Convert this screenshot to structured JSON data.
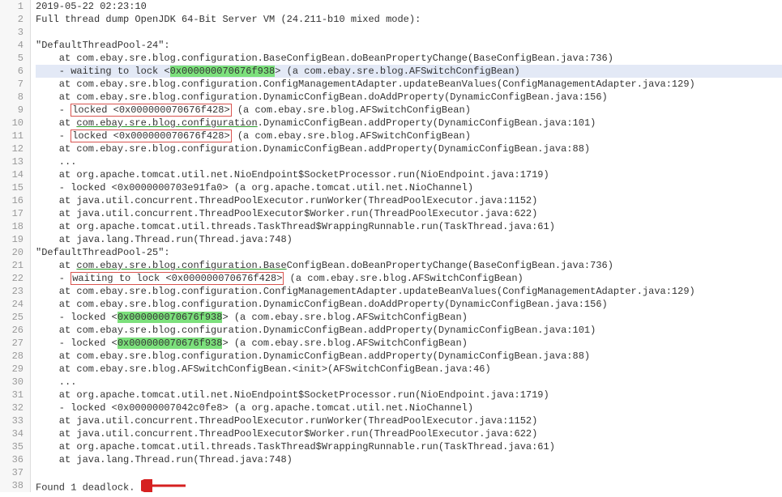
{
  "lines": [
    {
      "num": 1,
      "text": "2019-05-22 02:23:10"
    },
    {
      "num": 2,
      "text": "Full thread dump OpenJDK 64-Bit Server VM (24.211-b10 mixed mode):"
    },
    {
      "num": 3,
      "text": ""
    },
    {
      "num": 4,
      "text": "\"DefaultThreadPool-24\":"
    },
    {
      "num": 5,
      "text": "    at com.ebay.sre.blog.configuration.BaseConfigBean.doBeanPropertyChange(BaseConfigBean.java:736)"
    },
    {
      "num": 6,
      "highlighted": true,
      "parts": [
        {
          "t": "    - waiting to lock <"
        },
        {
          "t": "0x000000070676f938",
          "hlGreen": true
        },
        {
          "t": "> (a com.ebay.sre.blog.AFSwitchConfigBean)"
        }
      ]
    },
    {
      "num": 7,
      "text": "    at com.ebay.sre.blog.configuration.ConfigManagementAdapter.updateBeanValues(ConfigManagementAdapter.java:129)"
    },
    {
      "num": 8,
      "text": "    at com.ebay.sre.blog.configuration.DynamicConfigBean.doAddProperty(DynamicConfigBean.java:156)"
    },
    {
      "num": 9,
      "parts": [
        {
          "t": "    - "
        },
        {
          "t": "locked <0x000000070676f428>",
          "redBox": true
        },
        {
          "t": " (a com.ebay.sre.blog.AFSwitchConfigBean)"
        }
      ]
    },
    {
      "num": 10,
      "parts": [
        {
          "t": "    at "
        },
        {
          "t": "com.ebay.sre.blog.configuration",
          "greenUnderline": true
        },
        {
          "t": ".DynamicConfigBean.addProperty(DynamicConfigBean.java:101)"
        }
      ]
    },
    {
      "num": 11,
      "parts": [
        {
          "t": "    - "
        },
        {
          "t": "locked <0x000000070676f428>",
          "redBox": true
        },
        {
          "t": " (a com.ebay.sre.blog.AFSwitchConfigBean)"
        }
      ]
    },
    {
      "num": 12,
      "text": "    at com.ebay.sre.blog.configuration.DynamicConfigBean.addProperty(DynamicConfigBean.java:88)"
    },
    {
      "num": 13,
      "text": "    ..."
    },
    {
      "num": 14,
      "text": "    at org.apache.tomcat.util.net.NioEndpoint$SocketProcessor.run(NioEndpoint.java:1719)"
    },
    {
      "num": 15,
      "text": "    - locked <0x0000000703e91fa0> (a org.apache.tomcat.util.net.NioChannel)"
    },
    {
      "num": 16,
      "text": "    at java.util.concurrent.ThreadPoolExecutor.runWorker(ThreadPoolExecutor.java:1152)"
    },
    {
      "num": 17,
      "text": "    at java.util.concurrent.ThreadPoolExecutor$Worker.run(ThreadPoolExecutor.java:622)"
    },
    {
      "num": 18,
      "text": "    at org.apache.tomcat.util.threads.TaskThread$WrappingRunnable.run(TaskThread.java:61)"
    },
    {
      "num": 19,
      "text": "    at java.lang.Thread.run(Thread.java:748)"
    },
    {
      "num": 20,
      "text": "\"DefaultThreadPool-25\":"
    },
    {
      "num": 21,
      "parts": [
        {
          "t": "    at "
        },
        {
          "t": "com.ebay.sre.blog.configuration.Base",
          "greenUnderline": true
        },
        {
          "t": "ConfigBean.doBeanPropertyChange(BaseConfigBean.java:736)"
        }
      ]
    },
    {
      "num": 22,
      "parts": [
        {
          "t": "    - "
        },
        {
          "t": "waiting to lock <0x000000070676f428>",
          "redBox": true
        },
        {
          "t": " (a com.ebay.sre.blog.AFSwitchConfigBean)"
        }
      ]
    },
    {
      "num": 23,
      "text": "    at com.ebay.sre.blog.configuration.ConfigManagementAdapter.updateBeanValues(ConfigManagementAdapter.java:129)"
    },
    {
      "num": 24,
      "text": "    at com.ebay.sre.blog.configuration.DynamicConfigBean.doAddProperty(DynamicConfigBean.java:156)"
    },
    {
      "num": 25,
      "parts": [
        {
          "t": "    - locked <"
        },
        {
          "t": "0x000000070676f938",
          "hlGreen": true
        },
        {
          "t": "> (a com.ebay.sre.blog.AFSwitchConfigBean)"
        }
      ]
    },
    {
      "num": 26,
      "text": "    at com.ebay.sre.blog.configuration.DynamicConfigBean.addProperty(DynamicConfigBean.java:101)"
    },
    {
      "num": 27,
      "parts": [
        {
          "t": "    - locked <"
        },
        {
          "t": "0x000000070676f938",
          "hlGreen": true
        },
        {
          "t": "> (a com.ebay.sre.blog.AFSwitchConfigBean)"
        }
      ]
    },
    {
      "num": 28,
      "text": "    at com.ebay.sre.blog.configuration.DynamicConfigBean.addProperty(DynamicConfigBean.java:88)"
    },
    {
      "num": 29,
      "text": "    at com.ebay.sre.blog.AFSwitchConfigBean.<init>(AFSwitchConfigBean.java:46)"
    },
    {
      "num": 30,
      "text": "    ..."
    },
    {
      "num": 31,
      "text": "    at org.apache.tomcat.util.net.NioEndpoint$SocketProcessor.run(NioEndpoint.java:1719)"
    },
    {
      "num": 32,
      "text": "    - locked <0x00000007042c0fe8> (a org.apache.tomcat.util.net.NioChannel)"
    },
    {
      "num": 33,
      "text": "    at java.util.concurrent.ThreadPoolExecutor.runWorker(ThreadPoolExecutor.java:1152)"
    },
    {
      "num": 34,
      "text": "    at java.util.concurrent.ThreadPoolExecutor$Worker.run(ThreadPoolExecutor.java:622)"
    },
    {
      "num": 35,
      "text": "    at org.apache.tomcat.util.threads.TaskThread$WrappingRunnable.run(TaskThread.java:61)"
    },
    {
      "num": 36,
      "text": "    at java.lang.Thread.run(Thread.java:748)"
    },
    {
      "num": 37,
      "text": ""
    },
    {
      "num": 38,
      "text": "Found 1 deadlock.",
      "arrow": true
    }
  ]
}
